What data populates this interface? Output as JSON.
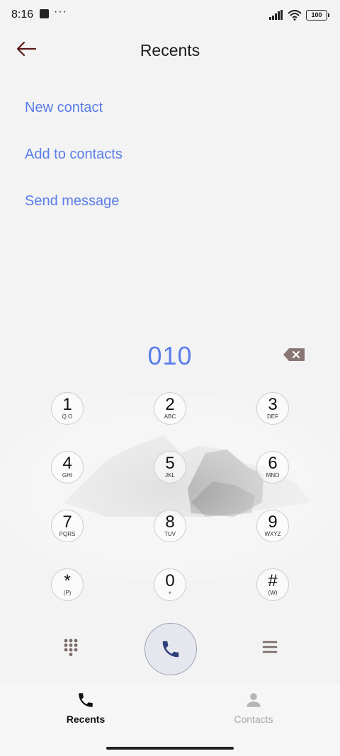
{
  "status_bar": {
    "time": "8:16",
    "dots": "···",
    "battery": "100"
  },
  "header": {
    "title": "Recents",
    "back_icon": "arrow-left-icon"
  },
  "actions": [
    {
      "label": "New contact"
    },
    {
      "label": "Add to contacts"
    },
    {
      "label": "Send message"
    }
  ],
  "dialer": {
    "number": "010",
    "backspace_icon": "backspace-icon"
  },
  "keypad": [
    {
      "digit": "1",
      "letters": "Q.O"
    },
    {
      "digit": "2",
      "letters": "ABC"
    },
    {
      "digit": "3",
      "letters": "DEF"
    },
    {
      "digit": "4",
      "letters": "GHI"
    },
    {
      "digit": "5",
      "letters": "JKL"
    },
    {
      "digit": "6",
      "letters": "MNO"
    },
    {
      "digit": "7",
      "letters": "PQRS"
    },
    {
      "digit": "8",
      "letters": "TUV"
    },
    {
      "digit": "9",
      "letters": "WXYZ"
    },
    {
      "digit": "*",
      "letters": "(P)"
    },
    {
      "digit": "0",
      "letters": "+"
    },
    {
      "digit": "#",
      "letters": "(W)"
    }
  ],
  "controls": {
    "dialpad_icon": "dialpad-grid-icon",
    "call_icon": "phone-icon",
    "menu_icon": "menu-icon"
  },
  "bottom_nav": {
    "recents": {
      "label": "Recents",
      "icon": "phone-icon"
    },
    "contacts": {
      "label": "Contacts",
      "icon": "person-icon"
    }
  },
  "colors": {
    "accent": "#5a7de9",
    "call_button": "#e6e7ee",
    "call_icon": "#2f3e78",
    "back_arrow": "#5a1a1a",
    "backspace": "#8a7672"
  }
}
